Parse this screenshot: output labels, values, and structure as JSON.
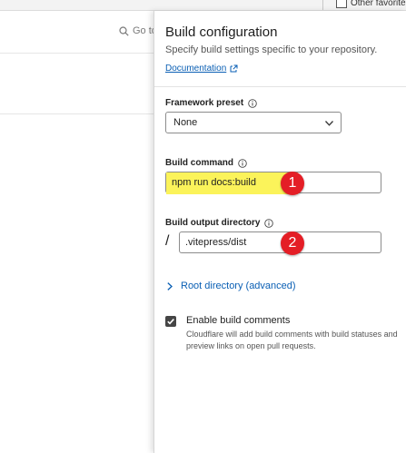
{
  "browser": {
    "bookmarks_bar": {
      "folder_label": "Other favorites"
    }
  },
  "background_page": {
    "search_placeholder": "Go to"
  },
  "panel": {
    "title": "Build configuration",
    "subtitle": "Specify build settings specific to your repository.",
    "documentation_link": "Documentation",
    "framework_preset": {
      "label": "Framework preset",
      "value": "None"
    },
    "build_command": {
      "label": "Build command",
      "value": "npm run docs:build",
      "highlight_color": "#fbf35a"
    },
    "build_output_directory": {
      "label": "Build output directory",
      "prefix": "/",
      "value": ".vitepress/dist"
    },
    "root_directory": {
      "label": "Root directory (advanced)"
    },
    "build_comments": {
      "checked": true,
      "label": "Enable build comments",
      "description": "Cloudflare will add build comments with build statuses and preview links on open pull requests."
    }
  },
  "annotations": [
    {
      "number": "1",
      "color": "#e41e26"
    },
    {
      "number": "2",
      "color": "#e41e26"
    }
  ],
  "colors": {
    "link": "#0a5fb4",
    "accent_badge": "#e41e26"
  }
}
